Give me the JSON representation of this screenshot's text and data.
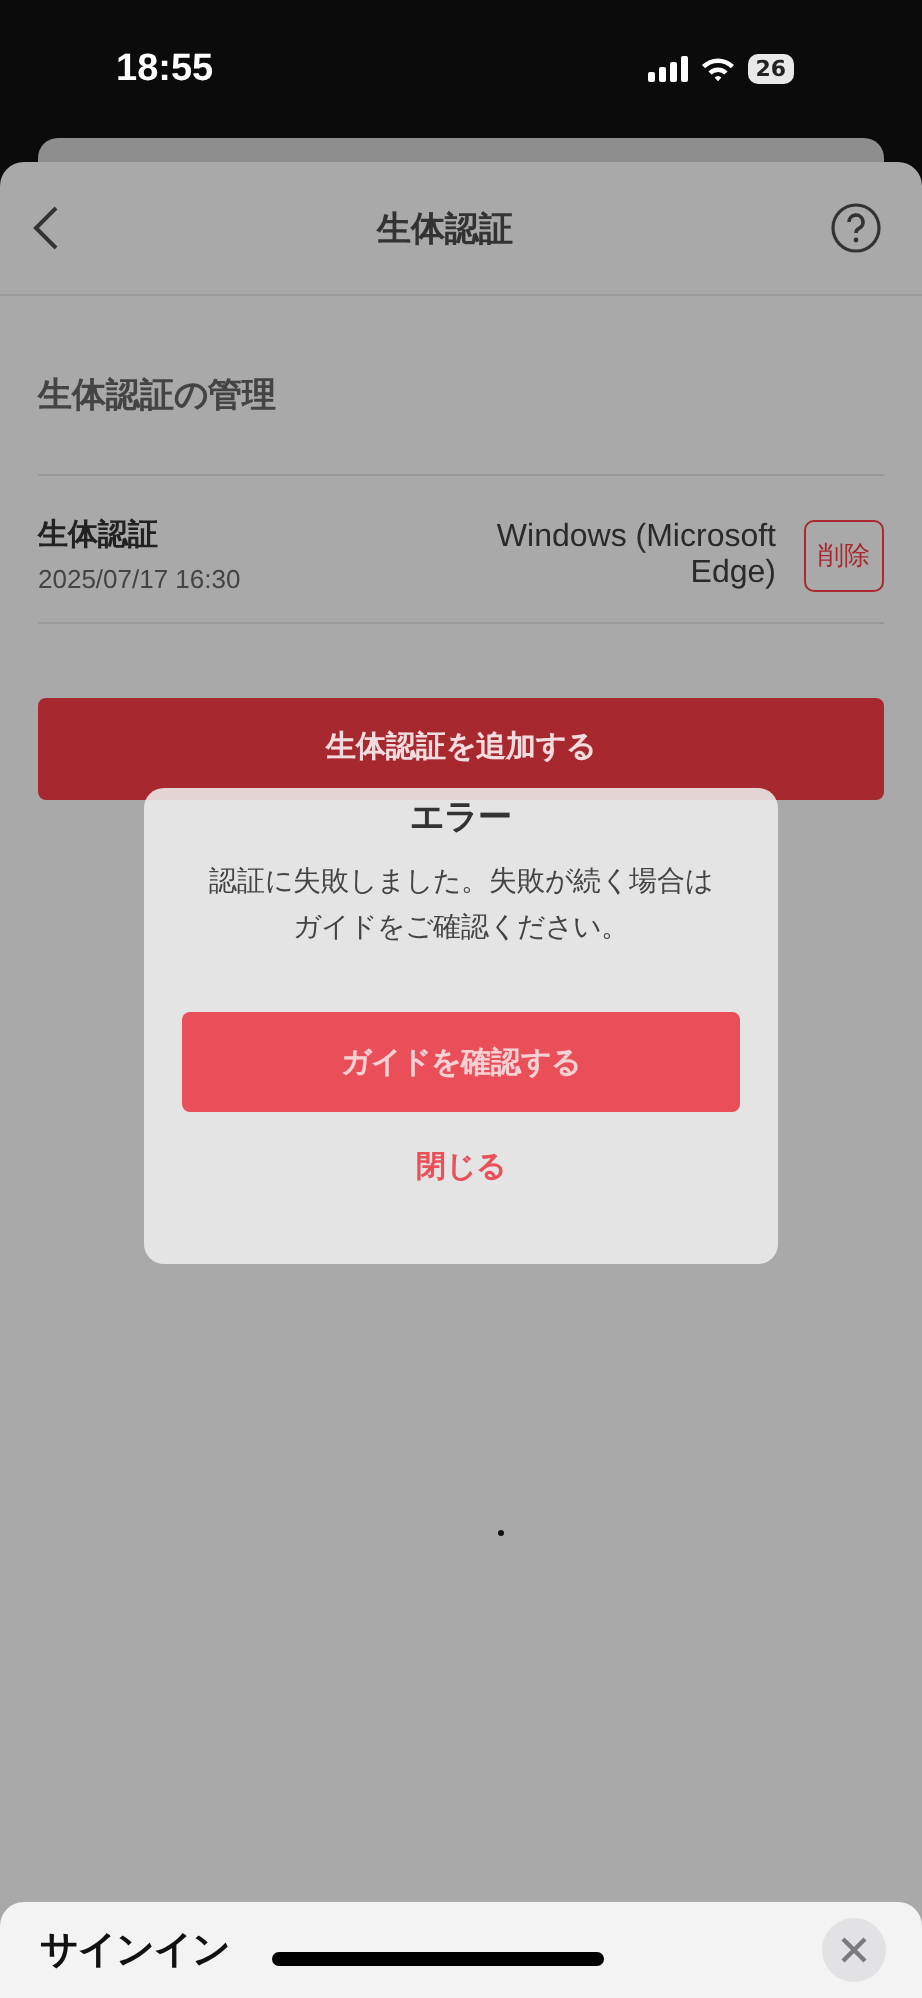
{
  "status_bar": {
    "time": "18:55",
    "battery": "26"
  },
  "header": {
    "title": "生体認証"
  },
  "section": {
    "title": "生体認証の管理"
  },
  "credentials": [
    {
      "name": "生体認証",
      "date": "2025/07/17 16:30",
      "device": "Windows (Microsoft Edge)",
      "delete_label": "削除"
    }
  ],
  "add_button": {
    "label": "生体認証を追加する"
  },
  "dialog": {
    "title": "エラー",
    "message": "認証に失敗しました。失敗が続く場合はガイドをご確認ください。",
    "primary_button": "ガイドを確認する",
    "secondary_button": "閉じる"
  },
  "bottom_sheet": {
    "title": "サインイン"
  }
}
